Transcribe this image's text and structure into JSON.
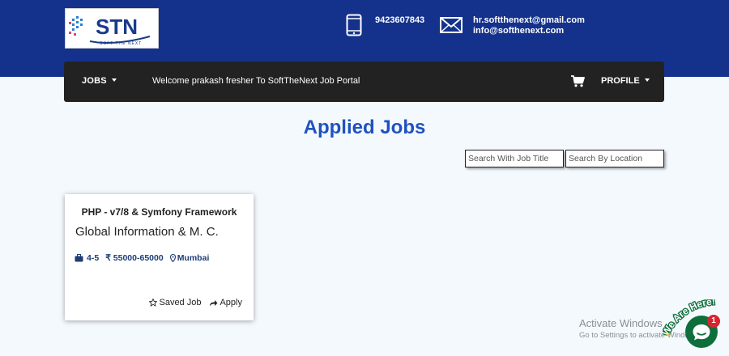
{
  "header": {
    "logo_text": "STN",
    "logo_tagline": "SOFT THE NEXT",
    "phone": "9423607843",
    "emails": [
      "hr.softthenext@gmail.com",
      "info@softhenext.com"
    ]
  },
  "navbar": {
    "jobs_label": "JOBS",
    "welcome": "Welcome prakash fresher To SoftTheNext Job Portal",
    "profile_label": "PROFILE"
  },
  "page": {
    "title": "Applied Jobs"
  },
  "search": {
    "title_placeholder": "Search With Job Title",
    "location_placeholder": "Search By Location"
  },
  "jobs": [
    {
      "title": "PHP - v7/8 & Symfony Framework",
      "company": "Global Information & M. C.",
      "experience": "4-5",
      "salary": "₹ 55000-65000",
      "location": "Mumbai",
      "saved_label": "Saved Job",
      "apply_label": "Apply"
    }
  ],
  "overlay": {
    "activate_title": "Activate Windows",
    "activate_sub": "Go to Settings to activate Windows.",
    "chat_tagline": "We Are Here!",
    "chat_badge": "1"
  },
  "colors": {
    "header_bg": "#14328c",
    "navbar_bg": "#222222",
    "title_blue": "#1f52c0",
    "chat_green": "#0e6f3c",
    "badge_red": "#d9232e"
  }
}
